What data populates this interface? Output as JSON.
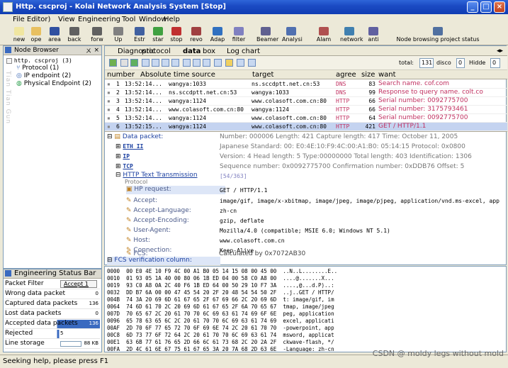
{
  "window": {
    "title": "Http. cscproj - Kolai Network Analysis System [Stop]"
  },
  "menu": [
    "File Editor)",
    "View",
    "Engineering",
    "Tool",
    "Window",
    "Help"
  ],
  "toolbar": [
    {
      "label": "new",
      "icon": "new-icon",
      "color": "#f0e6a0"
    },
    {
      "label": "ope",
      "icon": "open-icon",
      "color": "#e8c060"
    },
    {
      "label": "area",
      "icon": "save-icon",
      "color": "#3050a0"
    },
    {
      "label": "back",
      "icon": "back-icon",
      "color": "#606060"
    },
    {
      "label": "forw",
      "icon": "forward-icon",
      "color": "#606060"
    },
    {
      "label": "Up",
      "icon": "up-icon",
      "color": "#808080"
    },
    {
      "label": "Estr",
      "icon": "estr-icon",
      "color": "#4060a0"
    },
    {
      "label": "star",
      "icon": "start-icon",
      "color": "#40a040"
    },
    {
      "label": "stop",
      "icon": "stop-icon",
      "color": "#c03030"
    },
    {
      "label": "revo",
      "icon": "revo-icon",
      "color": "#a04040"
    },
    {
      "label": "Adap",
      "icon": "adapter-icon",
      "color": "#3070c0"
    },
    {
      "label": "filter",
      "icon": "filter-icon",
      "color": "#8080c0"
    },
    {
      "label": "Beamer",
      "icon": "beamer-icon",
      "color": "#606090"
    },
    {
      "label": "Analysi",
      "icon": "analysis-icon",
      "color": "#5070b0"
    },
    {
      "label": "Alam",
      "icon": "alarm-icon",
      "color": "#b05050"
    },
    {
      "label": "network",
      "icon": "network-icon",
      "color": "#4080b0"
    },
    {
      "label": "anti",
      "icon": "anti-icon",
      "color": "#6060a0"
    },
    {
      "label": "Node browsing project status",
      "icon": "node-status-icon",
      "color": "#5070a0"
    }
  ],
  "node_browser": {
    "title": "Node Browser",
    "pin": "×",
    "items": [
      {
        "label": "http. cscproj (3)",
        "indent": 0
      },
      {
        "label": "Protocol (1)",
        "indent": 1
      },
      {
        "label": "IP endpoint (2)",
        "indent": 1
      },
      {
        "label": "Physical Endpoint (2)",
        "indent": 1
      }
    ],
    "vertical_text": "Tian Tian Gun"
  },
  "engineering_status": {
    "title": "Engineering Status Bar",
    "rows": [
      {
        "label": "Packet Filter",
        "value": "Accept 1"
      },
      {
        "label": "Wrong data packet",
        "value": "0"
      },
      {
        "label": "Captured data packets",
        "value": "136"
      },
      {
        "label": "Lost data packets",
        "value": "0"
      },
      {
        "label": "Accepted data packets",
        "value": "136"
      },
      {
        "label": "Rejected",
        "value": "5"
      },
      {
        "label": "Line storage",
        "value": "88 KB"
      }
    ]
  },
  "tabs": [
    "Diagnostic",
    "protocol",
    "data",
    "box",
    "Log chart"
  ],
  "subtool": {
    "total_label": "total:",
    "total": "131",
    "disco_label": "disco",
    "disco": "0",
    "hidde_label": "Hidde",
    "hidde": "0"
  },
  "packet_columns": [
    "number",
    "Absolute time source",
    "target",
    "agree",
    "size",
    "want"
  ],
  "packets": [
    {
      "n": "1",
      "time": "13:52:14...",
      "src": "wangya:1033",
      "dst": "ns.sccdptt.net.cn:53",
      "proto": "DNS",
      "size": "83",
      "want": "Search name. cof.com",
      "pcolor": "#c03060"
    },
    {
      "n": "2",
      "time": "13:52:14...",
      "src": "ns.sccdptt.net.cn:53",
      "dst": "wangya:1033",
      "proto": "DNS",
      "size": "99",
      "want": "Response to query name. colt.co",
      "pcolor": "#c03060"
    },
    {
      "n": "3",
      "time": "13:52:14...",
      "src": "wangya:1124",
      "dst": "www.colasoft.com.cn:80",
      "proto": "HTTP",
      "size": "66",
      "want": "Serial number: 0092775700",
      "pcolor": "#c03060"
    },
    {
      "n": "4",
      "time": "13:52:14...",
      "src": "www.colasoft.com.cn:80",
      "dst": "wangya:1124",
      "proto": "HTTP",
      "size": "66",
      "want": "Serial number: 3175793461",
      "pcolor": "#c03060"
    },
    {
      "n": "5",
      "time": "13:52:14...",
      "src": "wangya:1124",
      "dst": "www.colasoft.com.cn:80",
      "proto": "HTTP",
      "size": "64",
      "want": "Serial number: 0092775700",
      "pcolor": "#c03060"
    },
    {
      "n": "6",
      "time": "13:52:15...",
      "src": "wangya:1124",
      "dst": "www.colasoft.com.cn:80",
      "proto": "HTTP",
      "size": "421",
      "want": "GET / HTTP/1.1",
      "pcolor": "#c03060"
    }
  ],
  "detail": {
    "data_packet": "Data packet:",
    "data_packet_val": "Number: 000006 Length: 421 Capture length: 417 Time: October 11, 2005",
    "eth": "ETH II",
    "eth_val": "Japanese Standard: 00: E0:4E:10:F9:4C:00:A1:B0: 05:14:15 Protocol: 0x0800",
    "ip": "IP",
    "ip_val": "Version: 4 Head length: 5 Type:00000000 Total length: 403 Identification: 1306",
    "tcp": "TCP",
    "tcp_val": "Sequence number: 0x0092775700 Confirmation number: 0xDDB76 Offset: 5",
    "http": "HTTP Text Transmission",
    "http_sub": "Protocol",
    "http_range": "[54/363]",
    "hp_request": "HP request:",
    "hp_request_val": "GET / HTTP/1.1",
    "fields": [
      {
        "k": "Accept:",
        "v": "image/gif, image/x-xbitmap, image/jpeg, image/pjpeg, application/vnd.ms-excel, app"
      },
      {
        "k": "Accept-Language:",
        "v": "zh-cn"
      },
      {
        "k": "Accept-Encoding:",
        "v": "gzip, deflate"
      },
      {
        "k": "User-Agent:",
        "v": "Mozilla/4.0 (compatible; MSIE 6.0; Windows NT 5.1)"
      },
      {
        "k": "Host:",
        "v": "www.colasoft.com.cn"
      },
      {
        "k": "Connection:",
        "v": "Keep-Alive"
      }
    ],
    "fcs_title": "FCS verification column:",
    "fcs_key": "FCS:",
    "fcs_val": "Calculated by 0x7072AB30"
  },
  "hex": [
    "0000  00 E0 4E 10 F9 4C 00 A1 B0 05 14 15 08 00 45 00  ..N..L........E..",
    "0010  01 93 05 1A 40 00 80 06 1B ED 04 00 58 C0 A8 00  ....@.......X...",
    "0019  93 C0 A8 0A 2C 40 F6 1B ED 64 00 50 29 10 F7 3A  ....,@...d.P)..:",
    "0032  DD B7 6A 00 00 47 45 54 20 2F 20 48 54 54 50 2F  ..j..GET / HTTP/",
    "004B  74 3A 20 69 6D 61 67 65 2F 67 69 66 2C 20 69 6D  t: image/gif, im",
    "0064  74 6D 61 70 2C 20 69 6D 61 67 65 2F 6A 70 65 67  tmap, image/jpeg",
    "007D  70 65 67 2C 20 61 70 70 6C 69 63 61 74 69 6F 6E  peg, application",
    "0096  65 78 63 65 6C 2C 20 61 70 70 6C 69 63 61 74 69  excel, applicati",
    "00AF  2D 70 6F 77 65 72 70 6F 69 6E 74 2C 20 61 70 70  -powerpoint, app",
    "00C8  6D 73 77 6F 72 64 2C 20 61 70 70 6C 69 63 61 74  msword, applicat",
    "00E1  63 6B 77 61 76 65 2D 66 6C 61 73 68 2C 20 2A 2F  ckwave-flash, */",
    "00FA  2D 4C 61 6E 67 75 61 67 65 3A 20 7A 68 2D 63 6E  -Language: zh-cn"
  ],
  "statusbar": "Seeking help, please press F1",
  "watermark": "CSDN @ moldy legs without mold"
}
